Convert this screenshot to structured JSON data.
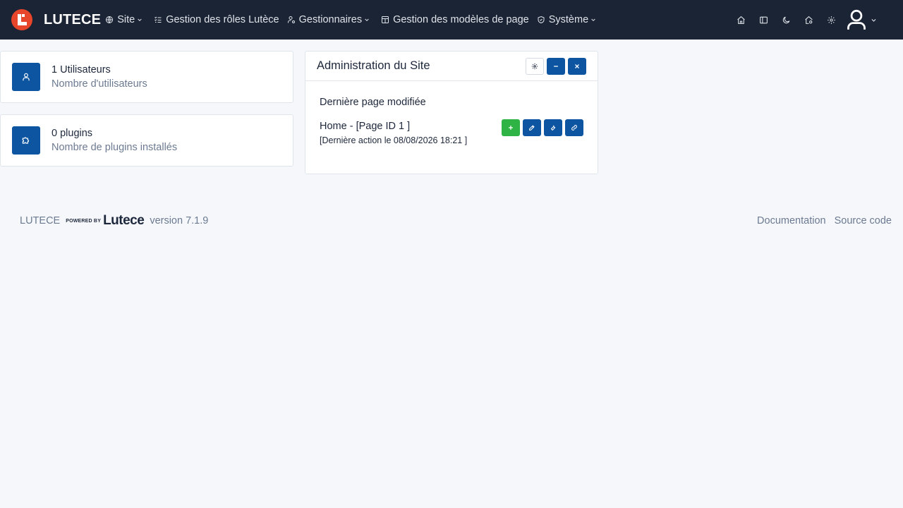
{
  "navbar": {
    "brand": "LUTECE",
    "menu": [
      {
        "label": "Site",
        "icon": "globe-icon",
        "dropdown": true
      },
      {
        "label": "Gestion des rôles Lutèce",
        "icon": "list-check-icon",
        "dropdown": false
      },
      {
        "label": "Gestionnaires",
        "icon": "user-cog-icon",
        "dropdown": true
      },
      {
        "label": "Gestion des modèles de page",
        "icon": "layout-icon",
        "dropdown": false
      },
      {
        "label": "Système",
        "icon": "shield-icon",
        "dropdown": true
      }
    ],
    "toolbar_icons": [
      "home-icon",
      "sidebar-toggle-icon",
      "moon-icon",
      "home-settings-icon",
      "gear-icon"
    ],
    "user_icon": "user-avatar-icon"
  },
  "stats": [
    {
      "value": "1 Utilisateurs",
      "label": "Nombre d'utilisateurs",
      "icon": "user-icon"
    },
    {
      "value": "0 plugins",
      "label": "Nombre de plugins installés",
      "icon": "puzzle-icon"
    }
  ],
  "admin_card": {
    "title": "Administration du Site",
    "header_buttons": [
      "settings-icon",
      "minimize-icon",
      "close-icon"
    ],
    "section_label": "Dernière page modifiée",
    "page": {
      "name": "Home - [Page ID 1 ]",
      "meta": "[Dernière action le 08/08/2026 18:21 ]"
    },
    "actions": [
      "add-icon",
      "edit-icon",
      "tool-icon",
      "link-icon"
    ]
  },
  "footer": {
    "name": "LUTECE",
    "powered_by": "POWERED BY",
    "powered_logo": "Lutece",
    "version": "version 7.1.9",
    "links": [
      "Documentation",
      "Source code"
    ]
  },
  "colors": {
    "navbar": "#1b2434",
    "primary": "#0d55a0",
    "success": "#2fb344",
    "logo": "#e8462a",
    "background": "#f5f7fb"
  }
}
